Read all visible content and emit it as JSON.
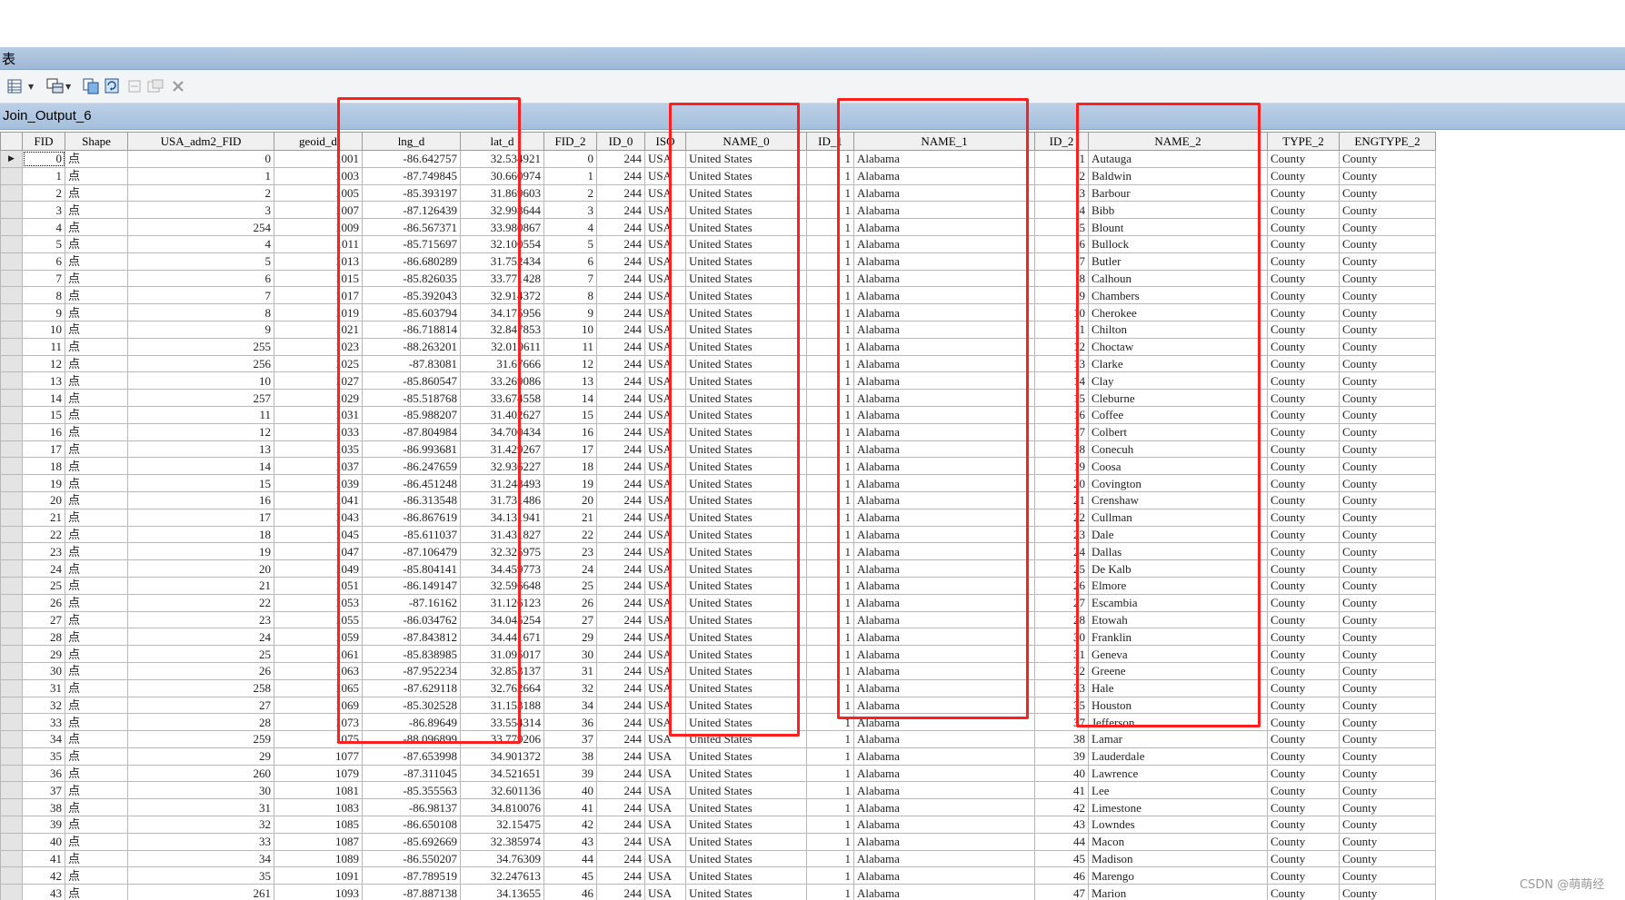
{
  "window": {
    "title": "表"
  },
  "layer": {
    "name": "Join_Output_6"
  },
  "toolbar": {
    "buttons": [
      {
        "icon": "table-options-icon",
        "has_dropdown": true
      },
      {
        "icon": "related-tables-icon",
        "has_dropdown": true
      },
      {
        "icon": "select-by-attributes-icon",
        "has_dropdown": false
      },
      {
        "icon": "switch-selection-icon",
        "has_dropdown": false
      },
      {
        "icon": "clear-selection-icon",
        "has_dropdown": false
      },
      {
        "icon": "zoom-to-selected-icon",
        "has_dropdown": false
      },
      {
        "icon": "delete-selected-icon",
        "has_dropdown": false
      }
    ]
  },
  "table": {
    "columns": [
      "FID",
      "Shape",
      "USA_adm2_FID",
      "geoid_d",
      "lng_d",
      "lat_d",
      "FID_2",
      "ID_0",
      "ISO",
      "NAME_0",
      "ID_1",
      "NAME_1",
      "ID_2",
      "NAME_2",
      "TYPE_2",
      "ENGTYPE_2"
    ],
    "rows": [
      [
        0,
        "点",
        0,
        1001,
        "-86.642757",
        "32.534921",
        0,
        244,
        "USA",
        "United States",
        1,
        "Alabama",
        1,
        "Autauga",
        "County",
        "County"
      ],
      [
        1,
        "点",
        1,
        1003,
        "-87.749845",
        "30.660974",
        1,
        244,
        "USA",
        "United States",
        1,
        "Alabama",
        2,
        "Baldwin",
        "County",
        "County"
      ],
      [
        2,
        "点",
        2,
        1005,
        "-85.393197",
        "31.869603",
        2,
        244,
        "USA",
        "United States",
        1,
        "Alabama",
        3,
        "Barbour",
        "County",
        "County"
      ],
      [
        3,
        "点",
        3,
        1007,
        "-87.126439",
        "32.998644",
        3,
        244,
        "USA",
        "United States",
        1,
        "Alabama",
        4,
        "Bibb",
        "County",
        "County"
      ],
      [
        4,
        "点",
        254,
        1009,
        "-86.567371",
        "33.980867",
        4,
        244,
        "USA",
        "United States",
        1,
        "Alabama",
        5,
        "Blount",
        "County",
        "County"
      ],
      [
        5,
        "点",
        4,
        1011,
        "-85.715697",
        "32.100554",
        5,
        244,
        "USA",
        "United States",
        1,
        "Alabama",
        6,
        "Bullock",
        "County",
        "County"
      ],
      [
        6,
        "点",
        5,
        1013,
        "-86.680289",
        "31.752434",
        6,
        244,
        "USA",
        "United States",
        1,
        "Alabama",
        7,
        "Butler",
        "County",
        "County"
      ],
      [
        7,
        "点",
        6,
        1015,
        "-85.826035",
        "33.771428",
        7,
        244,
        "USA",
        "United States",
        1,
        "Alabama",
        8,
        "Calhoun",
        "County",
        "County"
      ],
      [
        8,
        "点",
        7,
        1017,
        "-85.392043",
        "32.914372",
        8,
        244,
        "USA",
        "United States",
        1,
        "Alabama",
        9,
        "Chambers",
        "County",
        "County"
      ],
      [
        9,
        "点",
        8,
        1019,
        "-85.603794",
        "34.175956",
        9,
        244,
        "USA",
        "United States",
        1,
        "Alabama",
        10,
        "Cherokee",
        "County",
        "County"
      ],
      [
        10,
        "点",
        9,
        1021,
        "-86.718814",
        "32.847853",
        10,
        244,
        "USA",
        "United States",
        1,
        "Alabama",
        11,
        "Chilton",
        "County",
        "County"
      ],
      [
        11,
        "点",
        255,
        1023,
        "-88.263201",
        "32.019611",
        11,
        244,
        "USA",
        "United States",
        1,
        "Alabama",
        12,
        "Choctaw",
        "County",
        "County"
      ],
      [
        12,
        "点",
        256,
        1025,
        "-87.83081",
        "31.67666",
        12,
        244,
        "USA",
        "United States",
        1,
        "Alabama",
        13,
        "Clarke",
        "County",
        "County"
      ],
      [
        13,
        "点",
        10,
        1027,
        "-85.860547",
        "33.269086",
        13,
        244,
        "USA",
        "United States",
        1,
        "Alabama",
        14,
        "Clay",
        "County",
        "County"
      ],
      [
        14,
        "点",
        257,
        1029,
        "-85.518768",
        "33.674558",
        14,
        244,
        "USA",
        "United States",
        1,
        "Alabama",
        15,
        "Cleburne",
        "County",
        "County"
      ],
      [
        15,
        "点",
        11,
        1031,
        "-85.988207",
        "31.402627",
        15,
        244,
        "USA",
        "United States",
        1,
        "Alabama",
        16,
        "Coffee",
        "County",
        "County"
      ],
      [
        16,
        "点",
        12,
        1033,
        "-87.804984",
        "34.700434",
        16,
        244,
        "USA",
        "United States",
        1,
        "Alabama",
        17,
        "Colbert",
        "County",
        "County"
      ],
      [
        17,
        "点",
        13,
        1035,
        "-86.993681",
        "31.429267",
        17,
        244,
        "USA",
        "United States",
        1,
        "Alabama",
        18,
        "Conecuh",
        "County",
        "County"
      ],
      [
        18,
        "点",
        14,
        1037,
        "-86.247659",
        "32.936227",
        18,
        244,
        "USA",
        "United States",
        1,
        "Alabama",
        19,
        "Coosa",
        "County",
        "County"
      ],
      [
        19,
        "点",
        15,
        1039,
        "-86.451248",
        "31.248493",
        19,
        244,
        "USA",
        "United States",
        1,
        "Alabama",
        20,
        "Covington",
        "County",
        "County"
      ],
      [
        20,
        "点",
        16,
        1041,
        "-86.313548",
        "31.731486",
        20,
        244,
        "USA",
        "United States",
        1,
        "Alabama",
        21,
        "Crenshaw",
        "County",
        "County"
      ],
      [
        21,
        "点",
        17,
        1043,
        "-86.867619",
        "34.131941",
        21,
        244,
        "USA",
        "United States",
        1,
        "Alabama",
        22,
        "Cullman",
        "County",
        "County"
      ],
      [
        22,
        "点",
        18,
        1045,
        "-85.611037",
        "31.431827",
        22,
        244,
        "USA",
        "United States",
        1,
        "Alabama",
        23,
        "Dale",
        "County",
        "County"
      ],
      [
        23,
        "点",
        19,
        1047,
        "-87.106479",
        "32.325975",
        23,
        244,
        "USA",
        "United States",
        1,
        "Alabama",
        24,
        "Dallas",
        "County",
        "County"
      ],
      [
        24,
        "点",
        20,
        1049,
        "-85.804141",
        "34.459773",
        24,
        244,
        "USA",
        "United States",
        1,
        "Alabama",
        25,
        "De Kalb",
        "County",
        "County"
      ],
      [
        25,
        "点",
        21,
        1051,
        "-86.149147",
        "32.596648",
        25,
        244,
        "USA",
        "United States",
        1,
        "Alabama",
        26,
        "Elmore",
        "County",
        "County"
      ],
      [
        26,
        "点",
        22,
        1053,
        "-87.16162",
        "31.126123",
        26,
        244,
        "USA",
        "United States",
        1,
        "Alabama",
        27,
        "Escambia",
        "County",
        "County"
      ],
      [
        27,
        "点",
        23,
        1055,
        "-86.034762",
        "34.045254",
        27,
        244,
        "USA",
        "United States",
        1,
        "Alabama",
        28,
        "Etowah",
        "County",
        "County"
      ],
      [
        28,
        "点",
        24,
        1059,
        "-87.843812",
        "34.441671",
        29,
        244,
        "USA",
        "United States",
        1,
        "Alabama",
        30,
        "Franklin",
        "County",
        "County"
      ],
      [
        29,
        "点",
        25,
        1061,
        "-85.838985",
        "31.095017",
        30,
        244,
        "USA",
        "United States",
        1,
        "Alabama",
        31,
        "Geneva",
        "County",
        "County"
      ],
      [
        30,
        "点",
        26,
        1063,
        "-87.952234",
        "32.853137",
        31,
        244,
        "USA",
        "United States",
        1,
        "Alabama",
        32,
        "Greene",
        "County",
        "County"
      ],
      [
        31,
        "点",
        258,
        1065,
        "-87.629118",
        "32.762664",
        32,
        244,
        "USA",
        "United States",
        1,
        "Alabama",
        33,
        "Hale",
        "County",
        "County"
      ],
      [
        32,
        "点",
        27,
        1069,
        "-85.302528",
        "31.153188",
        34,
        244,
        "USA",
        "United States",
        1,
        "Alabama",
        35,
        "Houston",
        "County",
        "County"
      ],
      [
        33,
        "点",
        28,
        1073,
        "-86.89649",
        "33.554314",
        36,
        244,
        "USA",
        "United States",
        1,
        "Alabama",
        37,
        "Jefferson",
        "County",
        "County"
      ],
      [
        34,
        "点",
        259,
        1075,
        "-88.096899",
        "33.779206",
        37,
        244,
        "USA",
        "United States",
        1,
        "Alabama",
        38,
        "Lamar",
        "County",
        "County"
      ],
      [
        35,
        "点",
        29,
        1077,
        "-87.653998",
        "34.901372",
        38,
        244,
        "USA",
        "United States",
        1,
        "Alabama",
        39,
        "Lauderdale",
        "County",
        "County"
      ],
      [
        36,
        "点",
        260,
        1079,
        "-87.311045",
        "34.521651",
        39,
        244,
        "USA",
        "United States",
        1,
        "Alabama",
        40,
        "Lawrence",
        "County",
        "County"
      ],
      [
        37,
        "点",
        30,
        1081,
        "-85.355563",
        "32.601136",
        40,
        244,
        "USA",
        "United States",
        1,
        "Alabama",
        41,
        "Lee",
        "County",
        "County"
      ],
      [
        38,
        "点",
        31,
        1083,
        "-86.98137",
        "34.810076",
        41,
        244,
        "USA",
        "United States",
        1,
        "Alabama",
        42,
        "Limestone",
        "County",
        "County"
      ],
      [
        39,
        "点",
        32,
        1085,
        "-86.650108",
        "32.15475",
        42,
        244,
        "USA",
        "United States",
        1,
        "Alabama",
        43,
        "Lowndes",
        "County",
        "County"
      ],
      [
        40,
        "点",
        33,
        1087,
        "-85.692669",
        "32.385974",
        43,
        244,
        "USA",
        "United States",
        1,
        "Alabama",
        44,
        "Macon",
        "County",
        "County"
      ],
      [
        41,
        "点",
        34,
        1089,
        "-86.550207",
        "34.76309",
        44,
        244,
        "USA",
        "United States",
        1,
        "Alabama",
        45,
        "Madison",
        "County",
        "County"
      ],
      [
        42,
        "点",
        35,
        1091,
        "-87.789519",
        "32.247613",
        45,
        244,
        "USA",
        "United States",
        1,
        "Alabama",
        46,
        "Marengo",
        "County",
        "County"
      ],
      [
        43,
        "点",
        261,
        1093,
        "-87.887138",
        "34.13655",
        46,
        244,
        "USA",
        "United States",
        1,
        "Alabama",
        47,
        "Marion",
        "County",
        "County"
      ]
    ]
  },
  "highlight_color": "#ff1f1f",
  "watermark": "CSDN @萌萌经"
}
